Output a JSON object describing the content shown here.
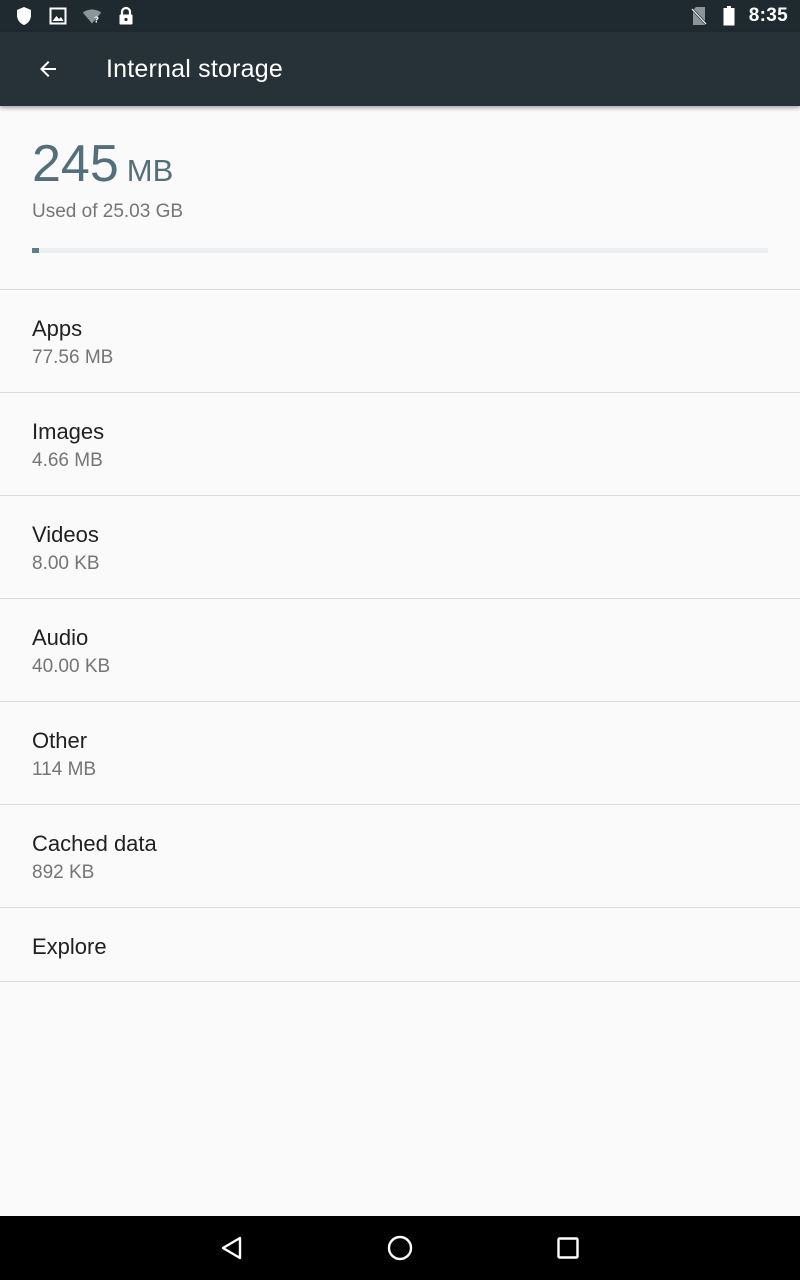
{
  "status_bar": {
    "time": "8:35",
    "icons_left": [
      "shield-icon",
      "image-icon",
      "wifi-unknown-icon",
      "lock-icon"
    ],
    "icons_right": [
      "no-sim-icon",
      "battery-icon"
    ]
  },
  "app_bar": {
    "title": "Internal storage",
    "back_icon": "arrow-left-icon"
  },
  "summary": {
    "used_value": "245",
    "used_unit": "MB",
    "used_of": "Used of 25.03 GB",
    "used_fraction": 0.0098
  },
  "categories": [
    {
      "title": "Apps",
      "size": "77.56 MB"
    },
    {
      "title": "Images",
      "size": "4.66 MB"
    },
    {
      "title": "Videos",
      "size": "8.00 KB"
    },
    {
      "title": "Audio",
      "size": "40.00 KB"
    },
    {
      "title": "Other",
      "size": "114 MB"
    },
    {
      "title": "Cached data",
      "size": "892 KB"
    }
  ],
  "explore": {
    "title": "Explore"
  },
  "nav_bar": {
    "icons": [
      "back-triangle-icon",
      "home-circle-icon",
      "recents-square-icon"
    ]
  },
  "colors": {
    "status_bar": "#1f2a30",
    "app_bar": "#263238",
    "accent": "#546e7a",
    "background": "#fafafa"
  }
}
